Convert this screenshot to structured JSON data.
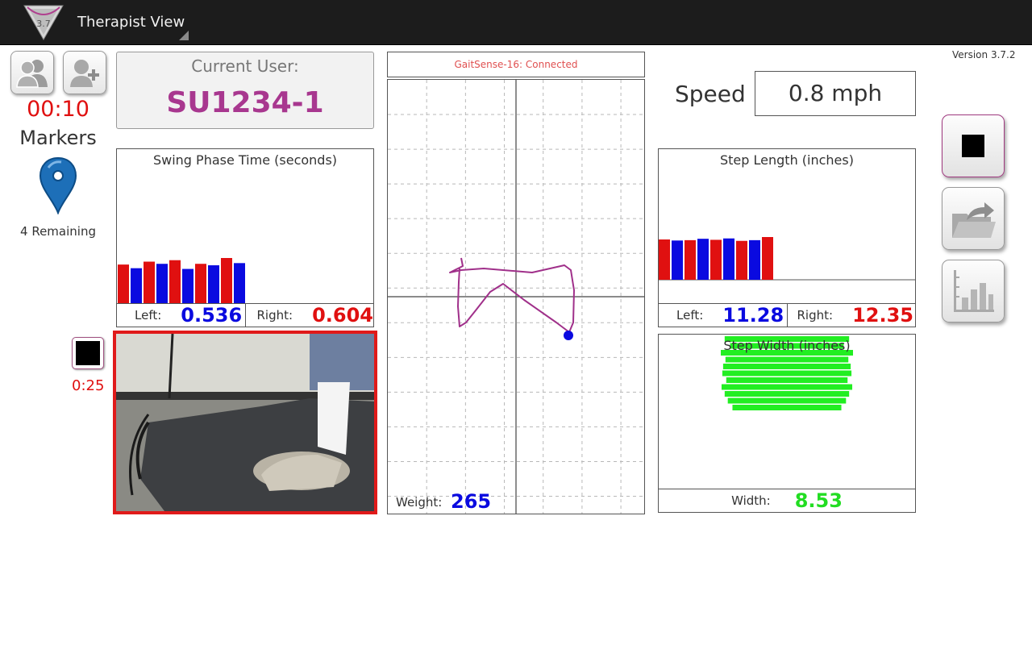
{
  "app": {
    "title": "Therapist View",
    "version": "Version 3.7.2",
    "logo_text": "3.7"
  },
  "left": {
    "timer": "00:10",
    "markers_label": "Markers",
    "remaining": "4 Remaining",
    "record_time": "0:25"
  },
  "user": {
    "label": "Current User:",
    "id": "SU1234-1"
  },
  "swing": {
    "title": "Swing Phase Time (seconds)",
    "left_label": "Left:",
    "left_value": "0.536",
    "right_label": "Right:",
    "right_value": "0.604"
  },
  "status": {
    "text": "GaitSense-16: Connected"
  },
  "weight": {
    "label": "Weight:",
    "value": "265"
  },
  "speed": {
    "label": "Speed",
    "value": "0.8 mph"
  },
  "step_length": {
    "title": "Step Length (inches)",
    "left_label": "Left:",
    "left_value": "11.28",
    "right_label": "Right:",
    "right_value": "12.35"
  },
  "step_width": {
    "title": "Step Width (inches)",
    "label": "Width:",
    "value": "8.53"
  },
  "icons": {
    "users": "users-icon",
    "add_user": "add-user-icon",
    "marker": "map-pin-icon",
    "stop": "stop-icon",
    "share": "folder-export-icon",
    "chart": "bar-chart-icon"
  },
  "colors": {
    "left": "#e01010",
    "right": "#0a0ae0",
    "width_bars": "#22ee22",
    "trace": "#a0308a",
    "accent_user": "#a8378f"
  },
  "chart_data": [
    {
      "type": "bar",
      "title": "Swing Phase Time (seconds)",
      "series": [
        {
          "name": "Left",
          "color": "#e01010",
          "values": [
            0.53,
            0.57,
            0.59,
            0.54,
            0.62
          ]
        },
        {
          "name": "Right",
          "color": "#0a0ae0",
          "values": [
            0.48,
            0.54,
            0.47,
            0.52,
            0.55
          ]
        }
      ],
      "order": "alternating"
    },
    {
      "type": "bar",
      "title": "Step Length (inches)",
      "series": [
        {
          "name": "Left",
          "color": "#e01010",
          "values": [
            11.6,
            11.4,
            11.5,
            11.2,
            12.3
          ]
        },
        {
          "name": "Right",
          "color": "#0a0ae0",
          "values": [
            11.3,
            11.8,
            11.9,
            11.4
          ]
        }
      ],
      "order": "alternating"
    },
    {
      "type": "bar",
      "orientation": "horizontal",
      "title": "Step Width (inches)",
      "values": [
        8.0,
        7.3,
        8.5,
        7.9,
        8.2,
        8.3,
        7.8,
        8.4,
        8.0,
        7.6,
        7.0
      ]
    }
  ],
  "trace": {
    "points": [
      [
        572,
        320
      ],
      [
        574,
        330
      ],
      [
        558,
        338
      ],
      [
        572,
        335
      ],
      [
        600,
        333
      ],
      [
        660,
        338
      ],
      [
        700,
        329
      ],
      [
        708,
        335
      ],
      [
        712,
        360
      ],
      [
        711,
        400
      ],
      [
        706,
        412
      ],
      [
        690,
        400
      ],
      [
        650,
        372
      ],
      [
        624,
        352
      ],
      [
        608,
        362
      ],
      [
        590,
        385
      ],
      [
        578,
        400
      ],
      [
        570,
        405
      ],
      [
        568,
        380
      ],
      [
        569,
        350
      ],
      [
        570,
        333
      ]
    ],
    "cursor": [
      705,
      416
    ]
  }
}
